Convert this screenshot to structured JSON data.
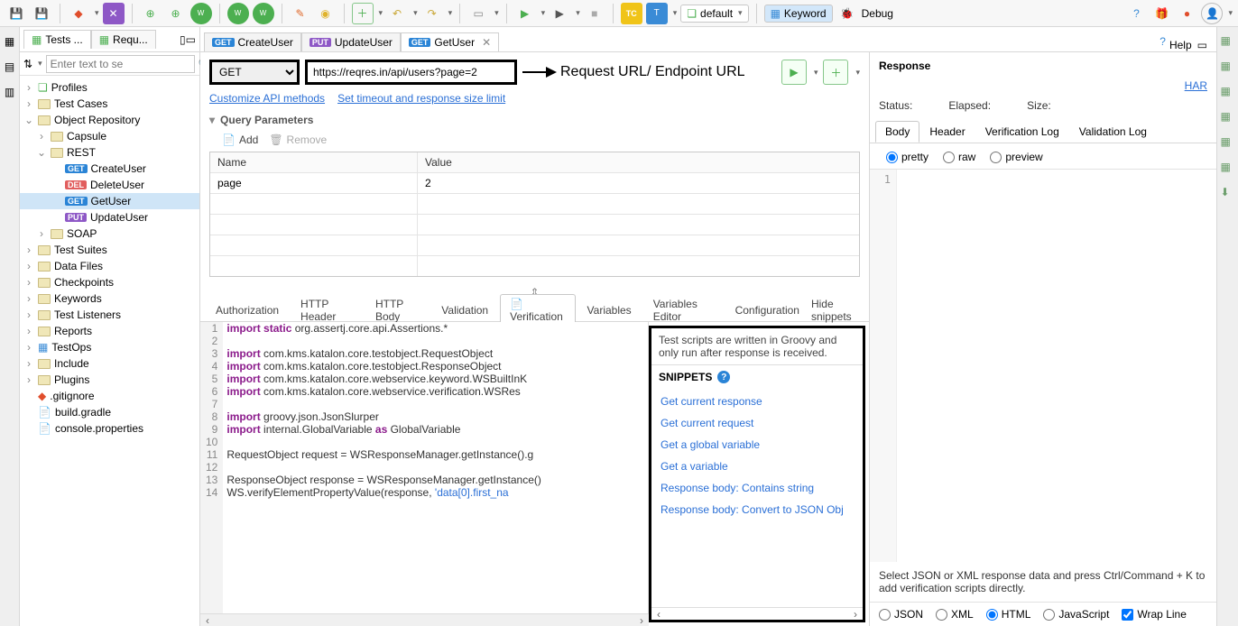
{
  "topToolbar": {
    "perspective_default": "default",
    "perspective_keyword": "Keyword",
    "perspective_debug": "Debug"
  },
  "leftTabs": {
    "tab1": "Tests ...",
    "tab2": "Requ..."
  },
  "search": {
    "placeholder": "Enter text to se"
  },
  "tree": {
    "profiles": "Profiles",
    "testCases": "Test Cases",
    "objectRepository": "Object Repository",
    "capsule": "Capsule",
    "rest": "REST",
    "createUser": "CreateUser",
    "deleteUser": "DeleteUser",
    "getUser": "GetUser",
    "updateUser": "UpdateUser",
    "soap": "SOAP",
    "testSuites": "Test Suites",
    "dataFiles": "Data Files",
    "checkpoints": "Checkpoints",
    "keywords": "Keywords",
    "testListeners": "Test Listeners",
    "reports": "Reports",
    "testOps": "TestOps",
    "include": "Include",
    "plugins": "Plugins",
    "gitignore": ".gitignore",
    "buildGradle": "build.gradle",
    "consoleProps": "console.properties"
  },
  "editorTabs": {
    "t1_method": "GET",
    "t1_label": "CreateUser",
    "t2_method": "PUT",
    "t2_label": "UpdateUser",
    "t3_method": "GET",
    "t3_label": "GetUser"
  },
  "request": {
    "method": "GET",
    "url": "https://reqres.in/api/users?page=2",
    "annotation": "Request URL/ Endpoint URL",
    "link1": "Customize API methods",
    "link2": "Set timeout and response size limit"
  },
  "qp": {
    "heading": "Query Parameters",
    "add": "Add",
    "remove": "Remove",
    "col_name": "Name",
    "col_value": "Value",
    "row1_name": "page",
    "row1_value": "2"
  },
  "subTabs": {
    "authorization": "Authorization",
    "httpHeader": "HTTP Header",
    "httpBody": "HTTP Body",
    "validation": "Validation",
    "verification": "Verification",
    "variables": "Variables",
    "variablesEditor": "Variables Editor",
    "configuration": "Configuration",
    "hideSnippets": "Hide snippets"
  },
  "code": {
    "l1a": "import static",
    "l1b": " org.assertj.core.api.Assertions.*",
    "l3": "import",
    "l3b": " com.kms.katalon.core.testobject.RequestObject",
    "l4": "import",
    "l4b": " com.kms.katalon.core.testobject.ResponseObject",
    "l5": "import",
    "l5b": " com.kms.katalon.core.webservice.keyword.WSBuiltInK",
    "l6": "import",
    "l6b": " com.kms.katalon.core.webservice.verification.WSRes",
    "l8": "import",
    "l8b": " groovy.json.JsonSlurper",
    "l9a": "import",
    "l9b": " internal.GlobalVariable ",
    "l9c": "as",
    "l9d": " GlobalVariable",
    "l11": "RequestObject request = WSResponseManager.getInstance().g",
    "l13": "ResponseObject response = WSResponseManager.getInstance()",
    "l14a": "WS.verifyElementPropertyValue(response, ",
    "l14b": "'data[0].first_na"
  },
  "lineNumbers": [
    "1",
    "2",
    "3",
    "4",
    "5",
    "6",
    "7",
    "8",
    "9",
    "10",
    "11",
    "12",
    "13",
    "14"
  ],
  "snippets": {
    "info": "Test scripts are written in Groovy and only run after response is received.",
    "heading": "SNIPPETS",
    "items": [
      "Get current response",
      "Get current request",
      "Get a global variable",
      "Get a variable",
      "Response body: Contains string",
      "Response body: Convert to JSON Obj"
    ]
  },
  "response": {
    "title": "Response",
    "help": "Help",
    "har": "HAR",
    "status": "Status:",
    "elapsed": "Elapsed:",
    "size": "Size:",
    "tab_body": "Body",
    "tab_header": "Header",
    "tab_vlog": "Verification Log",
    "tab_validlog": "Validation Log",
    "r_pretty": "pretty",
    "r_raw": "raw",
    "r_preview": "preview",
    "line1": "1",
    "note": "Select JSON or XML response data and press Ctrl/Command + K to add verification scripts directly.",
    "fmt_json": "JSON",
    "fmt_xml": "XML",
    "fmt_html": "HTML",
    "fmt_js": "JavaScript",
    "wrap": "Wrap Line"
  }
}
